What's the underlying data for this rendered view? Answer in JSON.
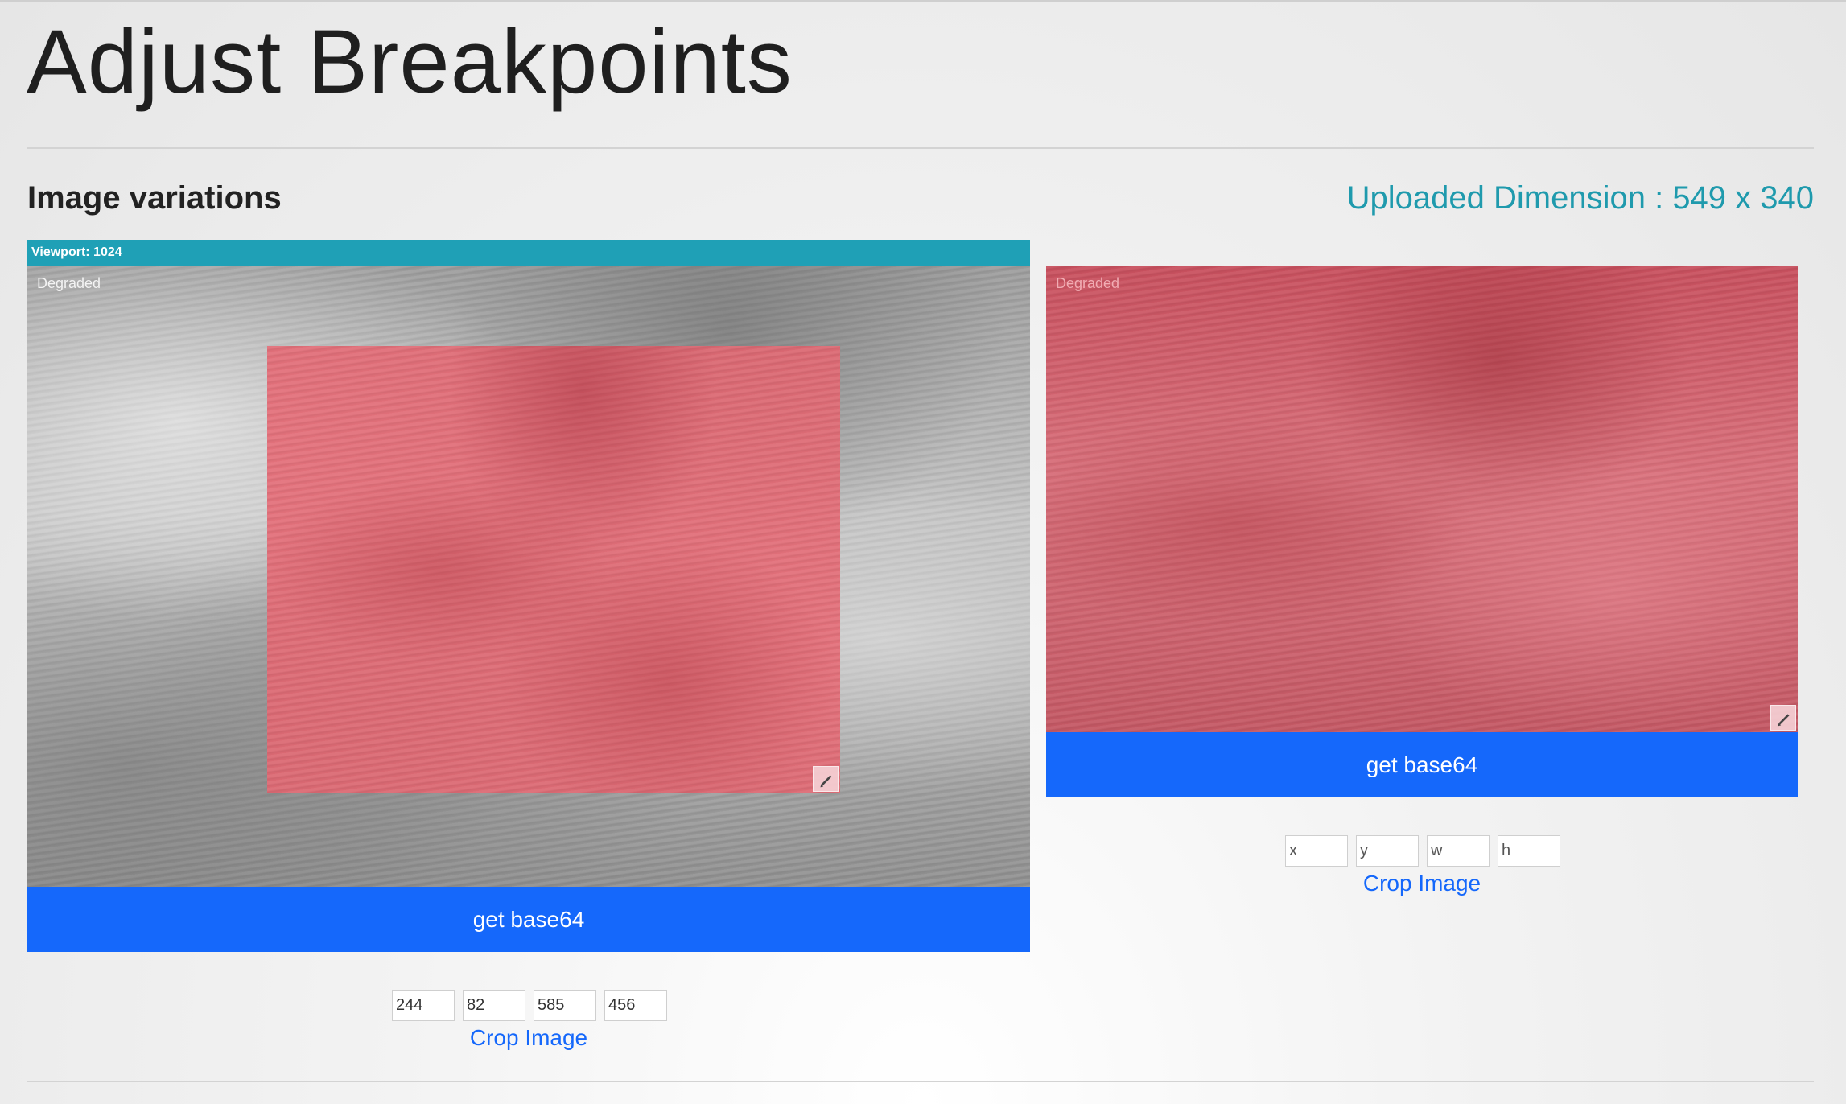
{
  "page": {
    "title": "Adjust Breakpoints"
  },
  "section": {
    "title": "Image variations",
    "uploaded_dimension": "Uploaded Dimension : 549 x 340"
  },
  "variations": [
    {
      "viewport_label": "Viewport: 1024",
      "degraded_label": "Degraded",
      "get_base64_label": "get base64",
      "crop_fields": {
        "x": "244",
        "y": "82",
        "w": "585",
        "h": "456"
      },
      "crop_placeholders": {
        "x": "x",
        "y": "y",
        "w": "w",
        "h": "h"
      },
      "crop_link_label": "Crop Image"
    },
    {
      "degraded_label": "Degraded",
      "get_base64_label": "get base64",
      "crop_fields": {
        "x": "",
        "y": "",
        "w": "",
        "h": ""
      },
      "crop_placeholders": {
        "x": "x",
        "y": "y",
        "w": "w",
        "h": "h"
      },
      "crop_link_label": "Crop Image"
    }
  ],
  "icons": {
    "resize_handle": "resize-handle-icon"
  },
  "colors": {
    "viewport_bar": "#1fa0b6",
    "button": "#1568fb",
    "dimension_text": "#1f9aad",
    "crop_overlay": "#e66470"
  }
}
